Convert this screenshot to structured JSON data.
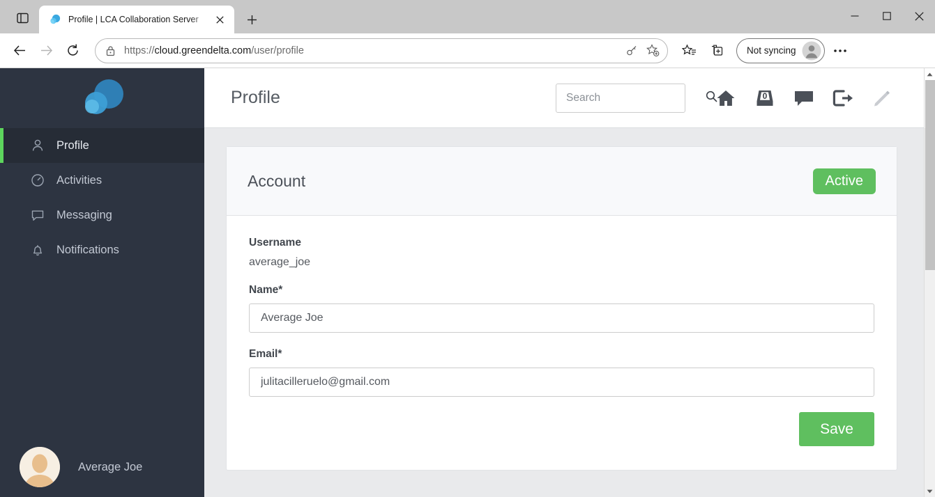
{
  "browser": {
    "tab": {
      "title": "Profile | LCA Collaboration Server",
      "favicon_name": "greendelta-cloud-favicon",
      "close_label": "×"
    },
    "new_tab_label": "+",
    "tab_search_name": "tab-search-icon",
    "window_controls": {
      "minimize": "—",
      "maximize": "□",
      "close": "✕"
    },
    "nav": {
      "back": "←",
      "forward": "→",
      "reload": "↻"
    },
    "omnibox": {
      "scheme": "https://",
      "host": "cloud.greendelta.com",
      "path": "/user/profile",
      "full_url": "https://cloud.greendelta.com/user/profile",
      "lock_icon": "lock-icon",
      "key_icon": "password-key-icon",
      "favorite_icon": "add-favorite-star-icon"
    },
    "toolbar": {
      "favorites_icon": "favorites-icon",
      "collections_icon": "collections-icon",
      "settings_icon": "settings-ellipsis-icon",
      "profile_label": "Not syncing",
      "profile_avatar_icon": "profile-avatar-icon"
    }
  },
  "sidebar": {
    "logo_name": "greendelta-cloud-logo",
    "items": [
      {
        "label": "Profile",
        "icon": "person-icon",
        "active": true
      },
      {
        "label": "Activities",
        "icon": "gauge-icon",
        "active": false
      },
      {
        "label": "Messaging",
        "icon": "chat-bubble-icon",
        "active": false
      },
      {
        "label": "Notifications",
        "icon": "bell-icon",
        "active": false
      }
    ],
    "user": {
      "name": "Average Joe",
      "avatar_name": "default-user-avatar"
    }
  },
  "header": {
    "title": "Profile",
    "search": {
      "placeholder": "Search",
      "value": "",
      "icon": "search-icon"
    },
    "icons": [
      {
        "name": "home-icon",
        "label": "Home"
      },
      {
        "name": "inbox-icon",
        "label": "Inbox",
        "badge": "0"
      },
      {
        "name": "chat-icon",
        "label": "Messages"
      },
      {
        "name": "logout-icon",
        "label": "Logout"
      },
      {
        "name": "edit-pencil-icon",
        "label": "Edit",
        "disabled": true
      }
    ]
  },
  "main": {
    "card": {
      "title": "Account",
      "status_badge": "Active",
      "fields": {
        "username": {
          "label": "Username",
          "value": "average_joe"
        },
        "name": {
          "label": "Name*",
          "value": "Average Joe",
          "placeholder": ""
        },
        "email": {
          "label": "Email*",
          "value": "julitacilleruelo@gmail.com",
          "placeholder": ""
        }
      },
      "save_label": "Save"
    }
  },
  "colors": {
    "accent_green": "#5fbf5f",
    "active_marker_green": "#5dd55d",
    "sidebar_bg": "#2d3441",
    "sidebar_active_bg": "#262c36",
    "page_bg": "#e9eaec",
    "card_head_bg": "#f8f9fb",
    "logo_blue": "#2f7fb5"
  }
}
